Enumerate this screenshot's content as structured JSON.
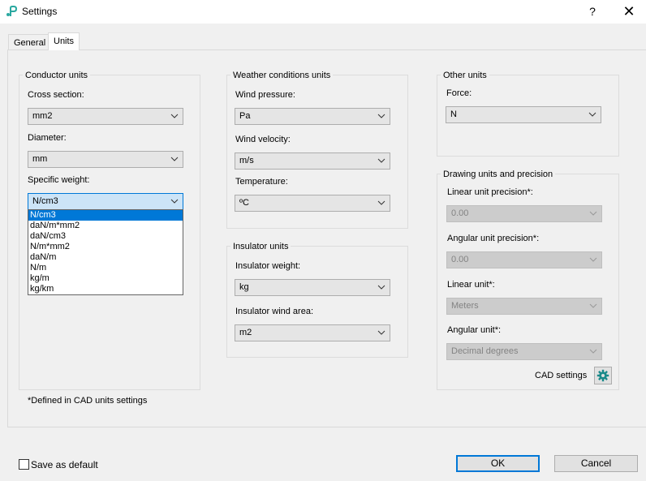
{
  "window": {
    "title": "Settings",
    "help_glyph": "?",
    "close_glyph": "✕"
  },
  "tabs": [
    {
      "label": "General"
    },
    {
      "label": "Units"
    }
  ],
  "conductor": {
    "title": "Conductor units",
    "cross_section_label": "Cross section:",
    "cross_section_value": "mm2",
    "diameter_label": "Diameter:",
    "diameter_value": "mm",
    "specific_weight_label": "Specific weight:",
    "specific_weight_value": "N/cm3",
    "specific_weight_options": [
      "N/cm3",
      "daN/m*mm2",
      "daN/cm3",
      "N/m*mm2",
      "daN/m",
      "N/m",
      "kg/m",
      "kg/km"
    ]
  },
  "weather": {
    "title": "Weather conditions units",
    "wind_pressure_label": "Wind pressure:",
    "wind_pressure_value": "Pa",
    "wind_velocity_label": "Wind velocity:",
    "wind_velocity_value": "m/s",
    "temperature_label": "Temperature:",
    "temperature_value": "ºC"
  },
  "insulator": {
    "title": "Insulator units",
    "weight_label": "Insulator weight:",
    "weight_value": "kg",
    "wind_area_label": "Insulator wind area:",
    "wind_area_value": "m2"
  },
  "other": {
    "title": "Other units",
    "force_label": "Force:",
    "force_value": "N"
  },
  "drawing": {
    "title": "Drawing units and precision",
    "linear_precision_label": "Linear unit precision*:",
    "linear_precision_value": "0.00",
    "angular_precision_label": "Angular unit precision*:",
    "angular_precision_value": "0.00",
    "linear_unit_label": "Linear unit*:",
    "linear_unit_value": "Meters",
    "angular_unit_label": "Angular unit*:",
    "angular_unit_value": "Decimal degrees",
    "cad_settings_label": "CAD settings"
  },
  "footnote": "*Defined in CAD units settings",
  "footer": {
    "save_default_label": "Save as default",
    "ok_label": "OK",
    "cancel_label": "Cancel"
  },
  "colors": {
    "accent": "#0078d7",
    "gear": "#1a8a8a",
    "app_icon": "#2aa8a0"
  }
}
